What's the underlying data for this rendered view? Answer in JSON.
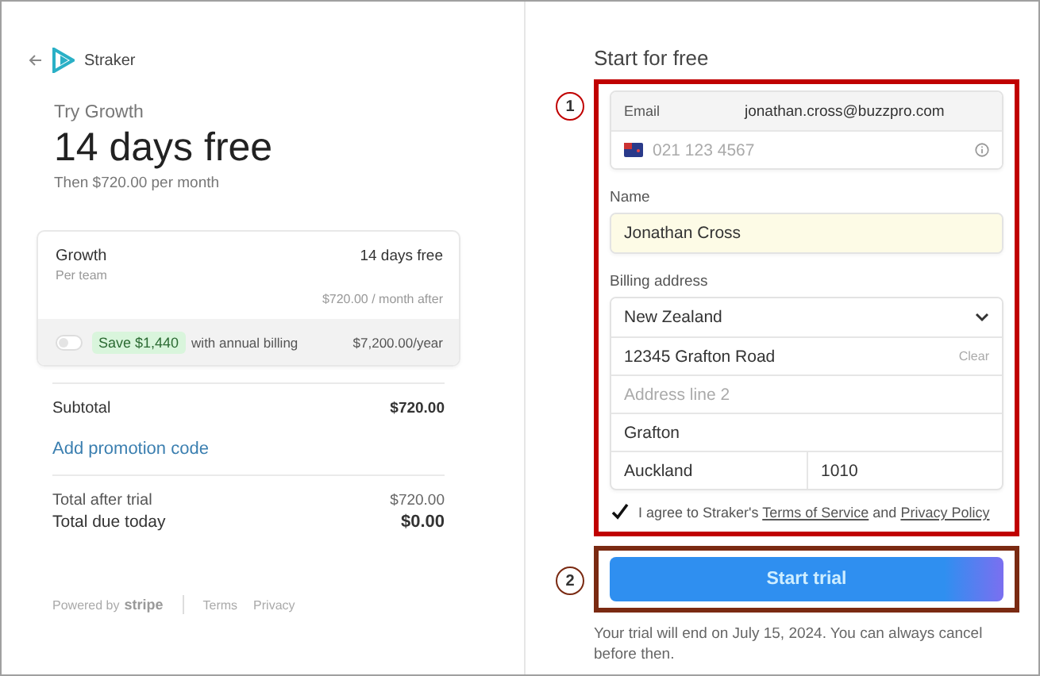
{
  "brand": {
    "name": "Straker"
  },
  "plan": {
    "eyebrow": "Try Growth",
    "headline": "14 days free",
    "subline": "Then $720.00 per month"
  },
  "summary_card": {
    "name": "Growth",
    "unit": "Per team",
    "trial": "14 days free",
    "after": "$720.00 / month after",
    "annual": {
      "on": false,
      "badge": "Save $1,440",
      "text": "with annual billing",
      "price": "$7,200.00/year"
    }
  },
  "totals": {
    "subtotal_label": "Subtotal",
    "subtotal": "$720.00",
    "promo_link": "Add promotion code",
    "after_trial_label": "Total after trial",
    "after_trial": "$720.00",
    "due_label": "Total due today",
    "due": "$0.00"
  },
  "footer": {
    "powered": "Powered by",
    "brand": "stripe",
    "links": [
      "Terms",
      "Privacy"
    ]
  },
  "form": {
    "title": "Start for free",
    "email": {
      "label": "Email",
      "value": "jonathan.cross@buzzpro.com"
    },
    "phone": {
      "placeholder": "021 123 4567"
    },
    "name": {
      "label": "Name",
      "value": "Jonathan Cross"
    },
    "billing": {
      "label": "Billing address",
      "country": "New Zealand",
      "line1": "12345 Grafton Road",
      "clear": "Clear",
      "line2_placeholder": "Address line 2",
      "suburb": "Grafton",
      "city": "Auckland",
      "postcode": "1010"
    },
    "terms": {
      "checked": true,
      "text": "I agree to Straker's",
      "terms_link": "Terms of Service",
      "and": "and",
      "privacy_link": "Privacy Policy"
    },
    "submit": "Start trial",
    "note": "Your trial will end on July 15, 2024. You can always cancel before then."
  },
  "annotations": [
    {
      "label": "1",
      "color": "#c00000"
    },
    {
      "label": "2",
      "color": "#7a2a12"
    }
  ]
}
